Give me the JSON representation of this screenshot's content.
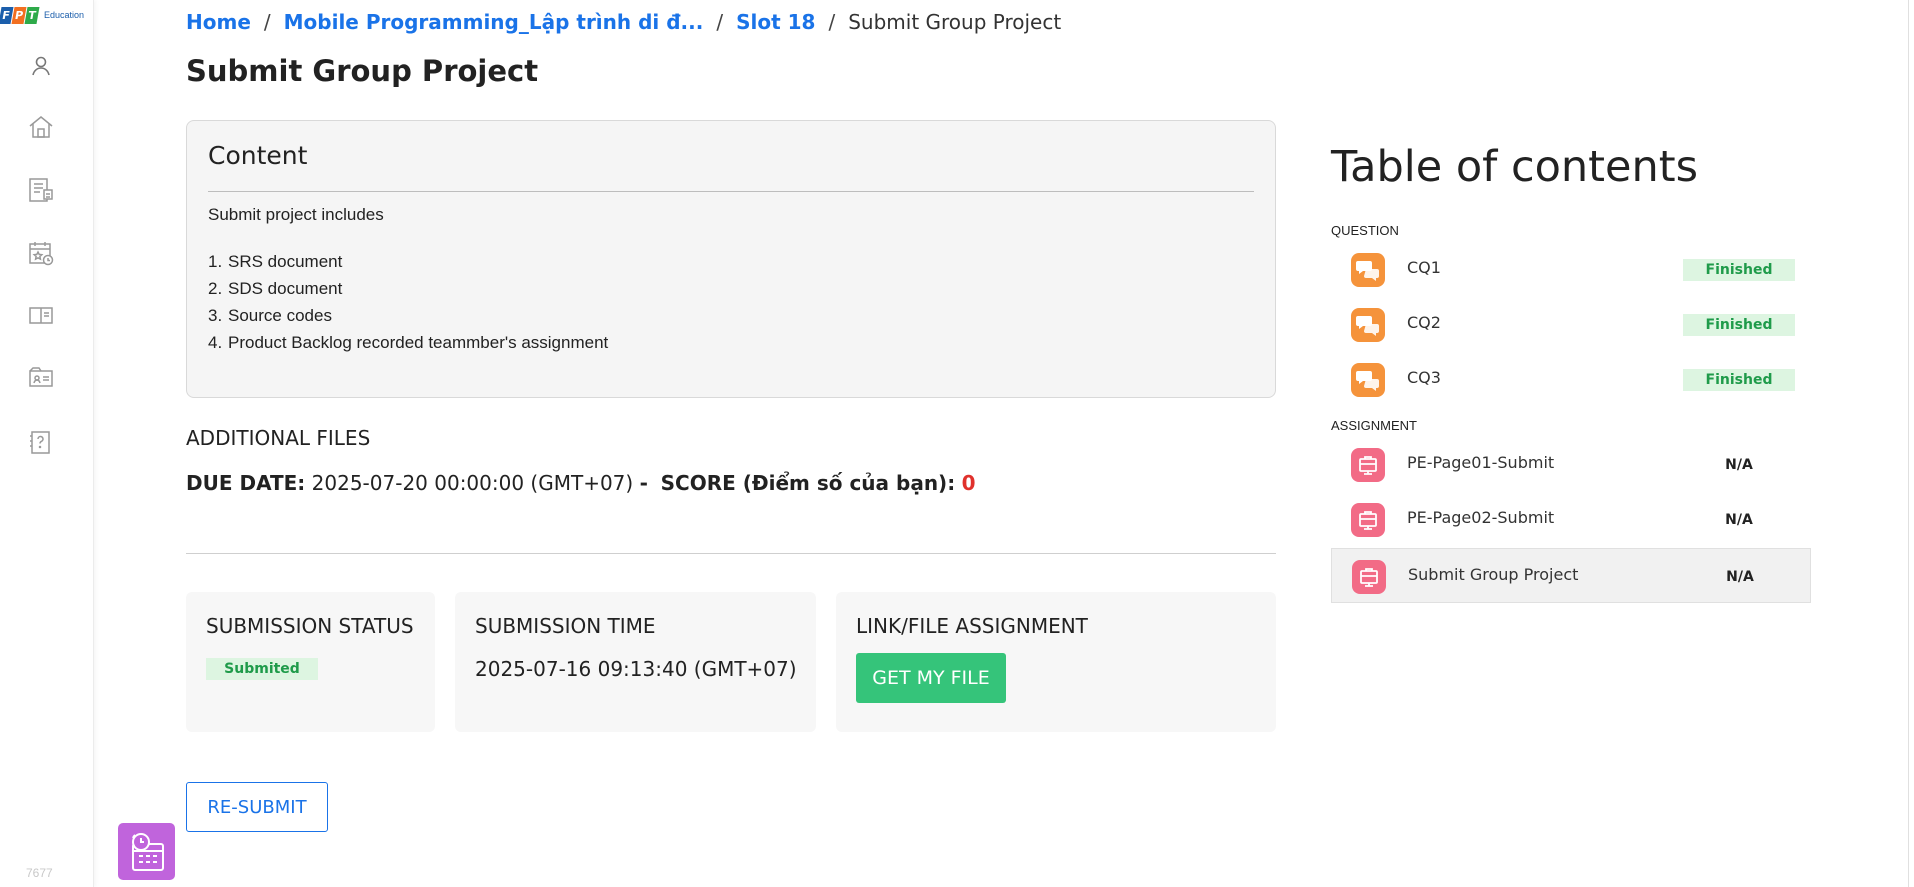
{
  "logo": {
    "letters": [
      "F",
      "P",
      "T"
    ],
    "letter_colors": [
      "#1b5eab",
      "#f26f21",
      "#2eaa4a"
    ],
    "sub": "Education"
  },
  "sidebar": {
    "items": [
      {
        "name": "user-icon"
      },
      {
        "name": "home-icon"
      },
      {
        "name": "documents-icon"
      },
      {
        "name": "calendar-icon"
      },
      {
        "name": "book-icon"
      },
      {
        "name": "folder-icon"
      },
      {
        "name": "help-icon"
      }
    ],
    "version": "7677"
  },
  "breadcrumb": {
    "home": "Home",
    "course": "Mobile Programming_Lập trình di đ...",
    "slot": "Slot 18",
    "current": "Submit Group Project",
    "sep": "/"
  },
  "page_title": "Submit Group Project",
  "content": {
    "title": "Content",
    "intro": "Submit project includes",
    "items": [
      {
        "num": "1.",
        "text": "SRS document"
      },
      {
        "num": "2.",
        "text": "SDS document"
      },
      {
        "num": "3.",
        "text": "Source codes"
      },
      {
        "num": "4.",
        "text": "Product Backlog recorded teammber's assignment"
      }
    ]
  },
  "additional_files": "ADDITIONAL FILES",
  "due": {
    "label": "DUE DATE:",
    "value": "2025-07-20 00:00:00 (GMT+07)",
    "dash": "-",
    "score_label": "SCORE (Điểm số của bạn):",
    "score_value": "0"
  },
  "submission_status": {
    "title": "SUBMISSION STATUS",
    "badge": "Submited"
  },
  "submission_time": {
    "title": "SUBMISSION TIME",
    "value": "2025-07-16 09:13:40 (GMT+07)"
  },
  "link_file": {
    "title": "LINK/FILE ASSIGNMENT",
    "button": "GET MY FILE"
  },
  "resubmit": "RE-SUBMIT",
  "toc": {
    "title": "Table of contents",
    "question_section": "QUESTION",
    "assignment_section": "ASSIGNMENT",
    "questions": [
      {
        "label": "CQ1",
        "status": "Finished"
      },
      {
        "label": "CQ2",
        "status": "Finished"
      },
      {
        "label": "CQ3",
        "status": "Finished"
      }
    ],
    "assignments": [
      {
        "label": "PE-Page01-Submit",
        "status": "N/A"
      },
      {
        "label": "PE-Page02-Submit",
        "status": "N/A"
      },
      {
        "label": "Submit Group Project",
        "status": "N/A",
        "active": true
      }
    ]
  },
  "colors": {
    "link": "#1a73e8",
    "success": "#35c47a",
    "badge_bg": "#ddf5e1",
    "badge_text": "#1f9b4a",
    "score": "#e0312c",
    "question_icon": "#f5933b",
    "assignment_icon": "#f26b86",
    "float_button": "#c064dc"
  }
}
